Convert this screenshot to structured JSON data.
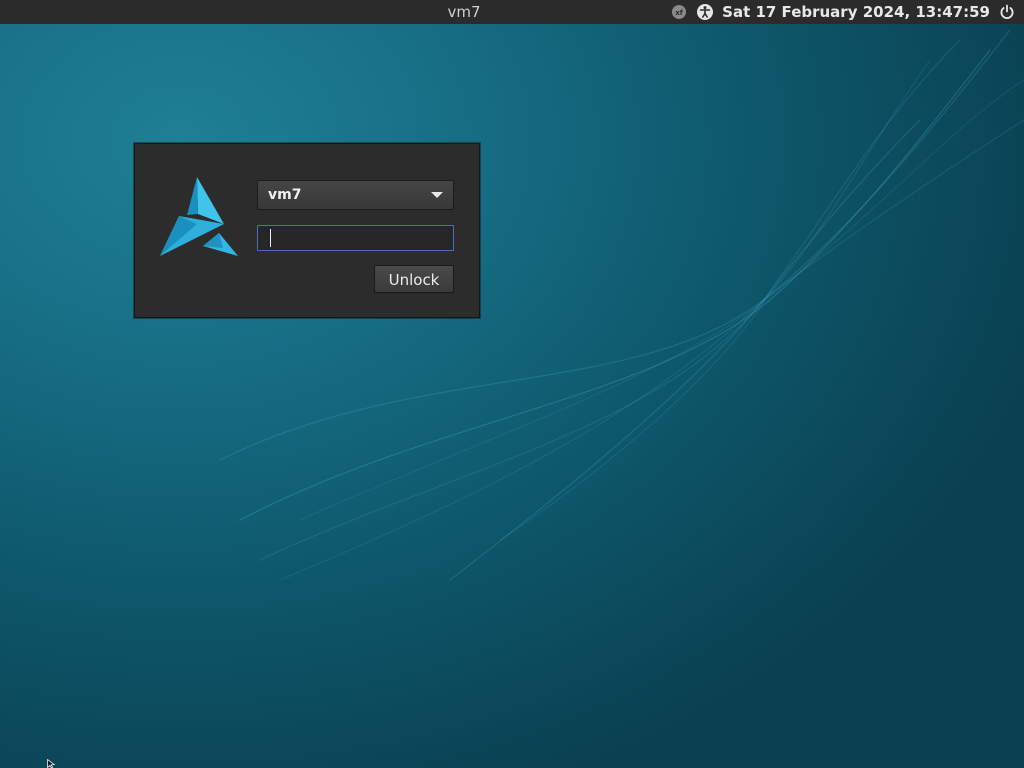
{
  "top_panel": {
    "hostname": "vm7",
    "clock": "Sat 17 February 2024, 13:47:59",
    "tray_icons": [
      "xfce-notification-icon",
      "accessibility-icon",
      "power-icon"
    ]
  },
  "lock_dialog": {
    "user_select": {
      "value": "vm7"
    },
    "password": {
      "value": "",
      "placeholder": ""
    },
    "unlock_label": "Unlock"
  },
  "colors": {
    "panel_bg": "#2b2b2b",
    "dialog_bg": "#2c2c2c",
    "wallpaper_teal": "#176f86",
    "logo_blue": "#2fb0dc",
    "input_focus_border": "#4a6fb5"
  }
}
